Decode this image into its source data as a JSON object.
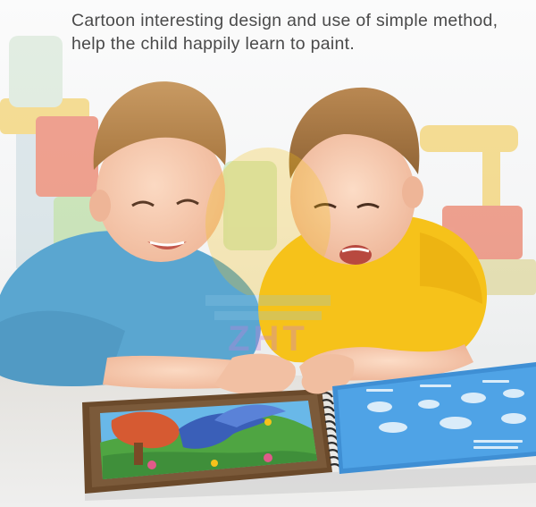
{
  "caption": {
    "line1": "Cartoon interesting design and use of simple method,",
    "line2": "help the child happily learn to paint."
  },
  "watermark": "ZHT",
  "colors": {
    "caption_text": "#4a4a4a",
    "blue_shirt": "#5aa6d0",
    "yellow_shirt": "#f6c21a",
    "book_cover_blue": "#3f8fd4",
    "book_page_blue": "#4fa3e6",
    "book_frame": "#6b4a2b",
    "floor": "#e9e9e8"
  }
}
